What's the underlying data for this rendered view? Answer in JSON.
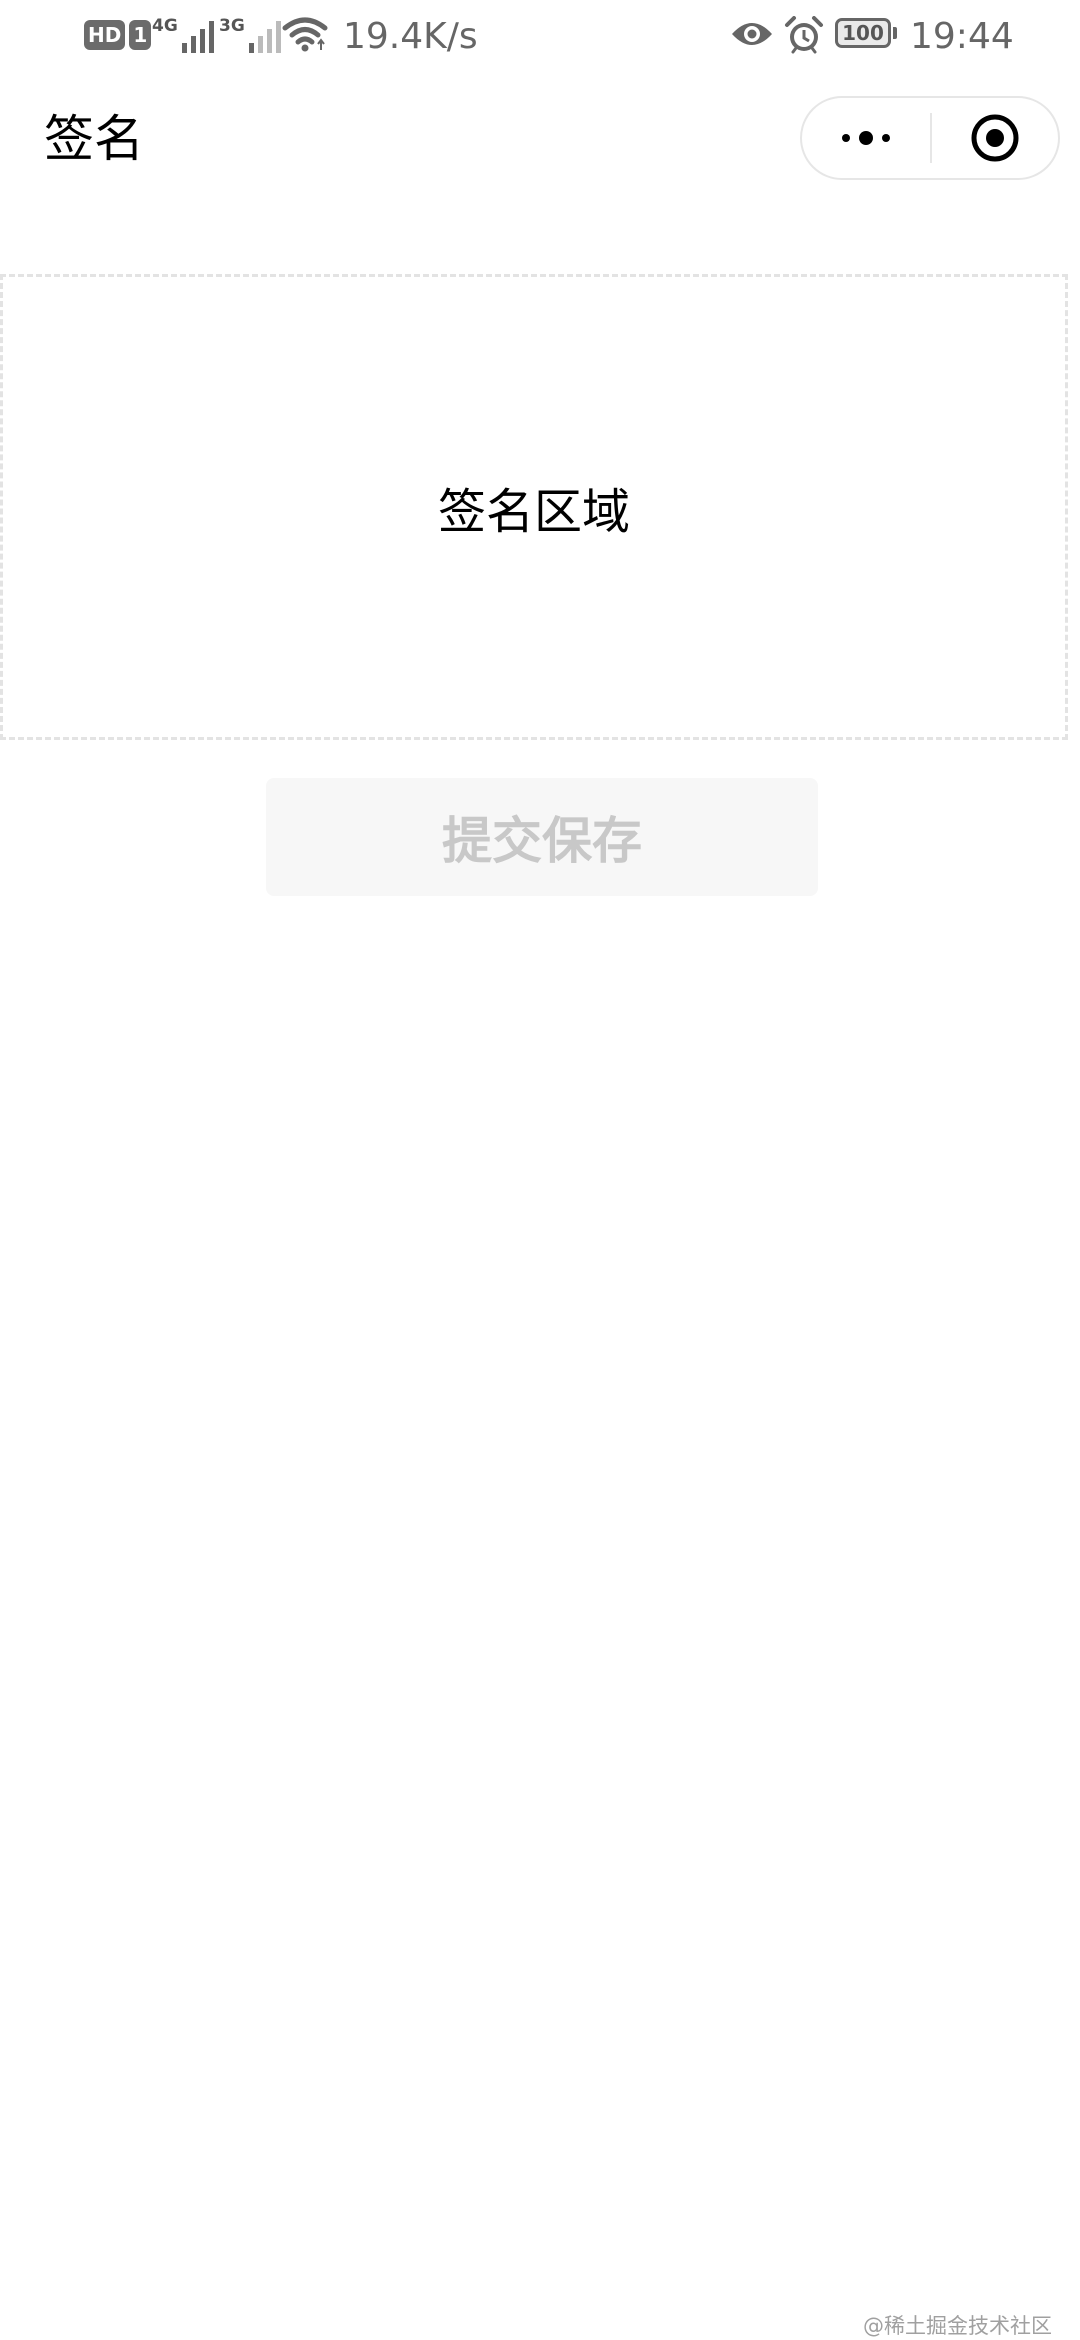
{
  "status_bar": {
    "hd_label": "HD",
    "sim_label": "1",
    "network_1": "4G",
    "network_2": "3G",
    "net_speed": "19.4K/s",
    "battery_level": "100",
    "time": "19:44",
    "icons": [
      "signal-icon",
      "wifi-icon",
      "eye-icon",
      "alarm-icon",
      "battery-icon"
    ]
  },
  "nav": {
    "title": "签名",
    "more_icon": "more-dots-icon",
    "close_icon": "target-circle-icon"
  },
  "signature": {
    "placeholder": "签名区域"
  },
  "actions": {
    "submit_label": "提交保存"
  },
  "watermark": "@稀土掘金技术社区",
  "colors": {
    "background": "#ffffff",
    "status_text": "#666666",
    "dashed_border": "#e3e3e3",
    "button_bg": "#f7f7f7",
    "button_text_disabled": "#c8c8c8"
  }
}
